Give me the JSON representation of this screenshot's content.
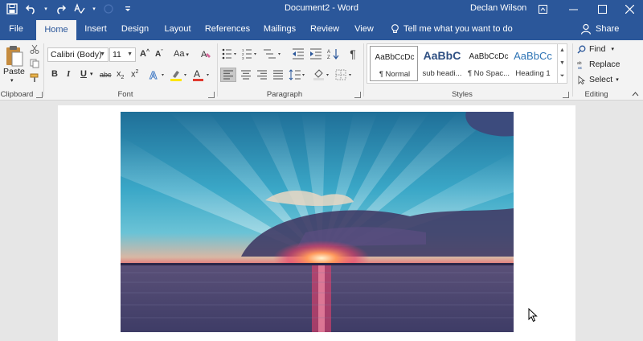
{
  "window": {
    "title": "Document2 - Word",
    "user": "Declan Wilson"
  },
  "tabs": [
    "File",
    "Home",
    "Insert",
    "Design",
    "Layout",
    "References",
    "Mailings",
    "Review",
    "View"
  ],
  "active_tab": "Home",
  "tell_me": "Tell me what you want to do",
  "share": "Share",
  "clipboard": {
    "paste": "Paste",
    "label": "Clipboard"
  },
  "font": {
    "family": "Calibri (Body)",
    "size": "11",
    "label": "Font",
    "color_accent": "#e03a2f",
    "highlight_accent": "#ffe600"
  },
  "paragraph": {
    "label": "Paragraph"
  },
  "styles": {
    "label": "Styles",
    "items": [
      {
        "sample": "AaBbCcDc",
        "name": "¶ Normal"
      },
      {
        "sample": "AaBbC",
        "name": "sub headi..."
      },
      {
        "sample": "AaBbCcDc",
        "name": "¶ No Spac..."
      },
      {
        "sample": "AaBbCc",
        "name": "Heading 1"
      }
    ]
  },
  "editing": {
    "label": "Editing",
    "find": "Find",
    "replace": "Replace",
    "select": "Select"
  },
  "colors": {
    "brand": "#2b579a",
    "ribbon": "#f3f3f3",
    "canvas": "#e6e6e6"
  }
}
